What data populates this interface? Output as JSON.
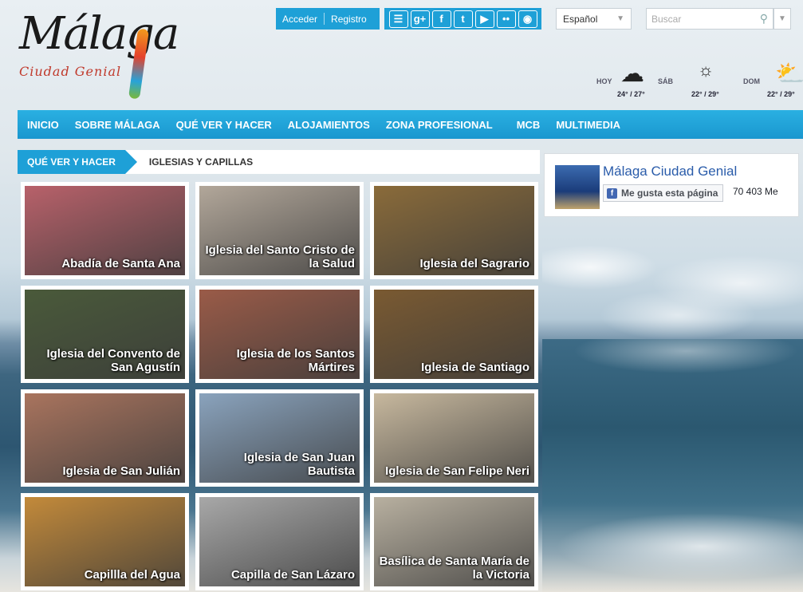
{
  "header": {
    "logo_word": "Málaga",
    "logo_sub": "Ciudad Genial",
    "login": "Acceder",
    "register": "Registro",
    "social": [
      {
        "name": "rss-icon",
        "glyph": "☰"
      },
      {
        "name": "google-plus-icon",
        "glyph": "g+"
      },
      {
        "name": "facebook-icon",
        "glyph": "f"
      },
      {
        "name": "twitter-icon",
        "glyph": "t"
      },
      {
        "name": "youtube-icon",
        "glyph": "▶"
      },
      {
        "name": "flickr-icon",
        "glyph": "••"
      },
      {
        "name": "instagram-icon",
        "glyph": "◉"
      }
    ],
    "language": "Español",
    "search_placeholder": "Buscar"
  },
  "weather": [
    {
      "day": "HOY",
      "temp": "24° / 27°",
      "icon": "cloud-icon"
    },
    {
      "day": "SÁB",
      "temp": "22° / 29°",
      "icon": "sun-icon"
    },
    {
      "day": "DOM",
      "temp": "22° / 29°",
      "icon": "partly-cloudy-icon"
    }
  ],
  "nav": [
    "INICIO",
    "SOBRE MÁLAGA",
    "QUÉ VER Y HACER",
    "ALOJAMIENTOS",
    "ZONA PROFESIONAL",
    "MCB",
    "MULTIMEDIA"
  ],
  "breadcrumb": {
    "section": "QUÉ VER Y HACER",
    "page": "IGLESIAS Y CAPILLAS"
  },
  "cards": [
    {
      "title": "Abadía de Santa Ana",
      "bg": "#b8616a"
    },
    {
      "title": "Iglesia del Santo Cristo de la Salud",
      "bg": "#b2a79a"
    },
    {
      "title": "Iglesia del Sagrario",
      "bg": "#8a6b3a"
    },
    {
      "title": "Iglesia del Convento de San Agustín",
      "bg": "#4a5a3a"
    },
    {
      "title": "Iglesia de los Santos Mártires",
      "bg": "#9a5b48"
    },
    {
      "title": "Iglesia de Santiago",
      "bg": "#7a5a32"
    },
    {
      "title": "Iglesia de San Julián",
      "bg": "#a9745e"
    },
    {
      "title": "Iglesia de San Juan Bautista",
      "bg": "#8aa3bd"
    },
    {
      "title": "Iglesia de San Felipe Neri",
      "bg": "#c7b89e"
    },
    {
      "title": "Capillla del Agua",
      "bg": "#c38a3a"
    },
    {
      "title": "Capilla de San Lázaro",
      "bg": "#a8a8a8"
    },
    {
      "title": "Basílica de Santa María de la Victoria",
      "bg": "#b8b0a0"
    }
  ],
  "facebook": {
    "title": "Málaga Ciudad Genial",
    "like": "Me gusta esta página",
    "count": "70 403 Me"
  },
  "colors": {
    "accent": "#1ea0d7",
    "fb": "#4267b2"
  }
}
